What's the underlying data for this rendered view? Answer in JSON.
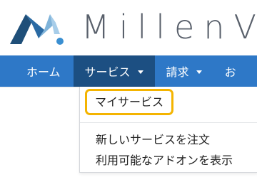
{
  "logo": {
    "text": "MillenVP",
    "mark_icon": "millen-logo-mark-icon",
    "mark_color_dark": "#1f4f79",
    "mark_color_light": "#7fb3d9",
    "mark_dot_color": "#3a8fd1"
  },
  "navbar": {
    "color": "#2e78c7",
    "active_color": "#1c4f82",
    "items": [
      {
        "label": "ホーム"
      },
      {
        "label": "サービス"
      },
      {
        "label": "請求"
      },
      {
        "label": "お"
      }
    ]
  },
  "dropdown": {
    "highlight_color": "#f4b400",
    "items": [
      {
        "label": "マイサービス"
      },
      {
        "label": "新しいサービスを注文"
      },
      {
        "label": "利用可能なアドオンを表示"
      }
    ]
  }
}
